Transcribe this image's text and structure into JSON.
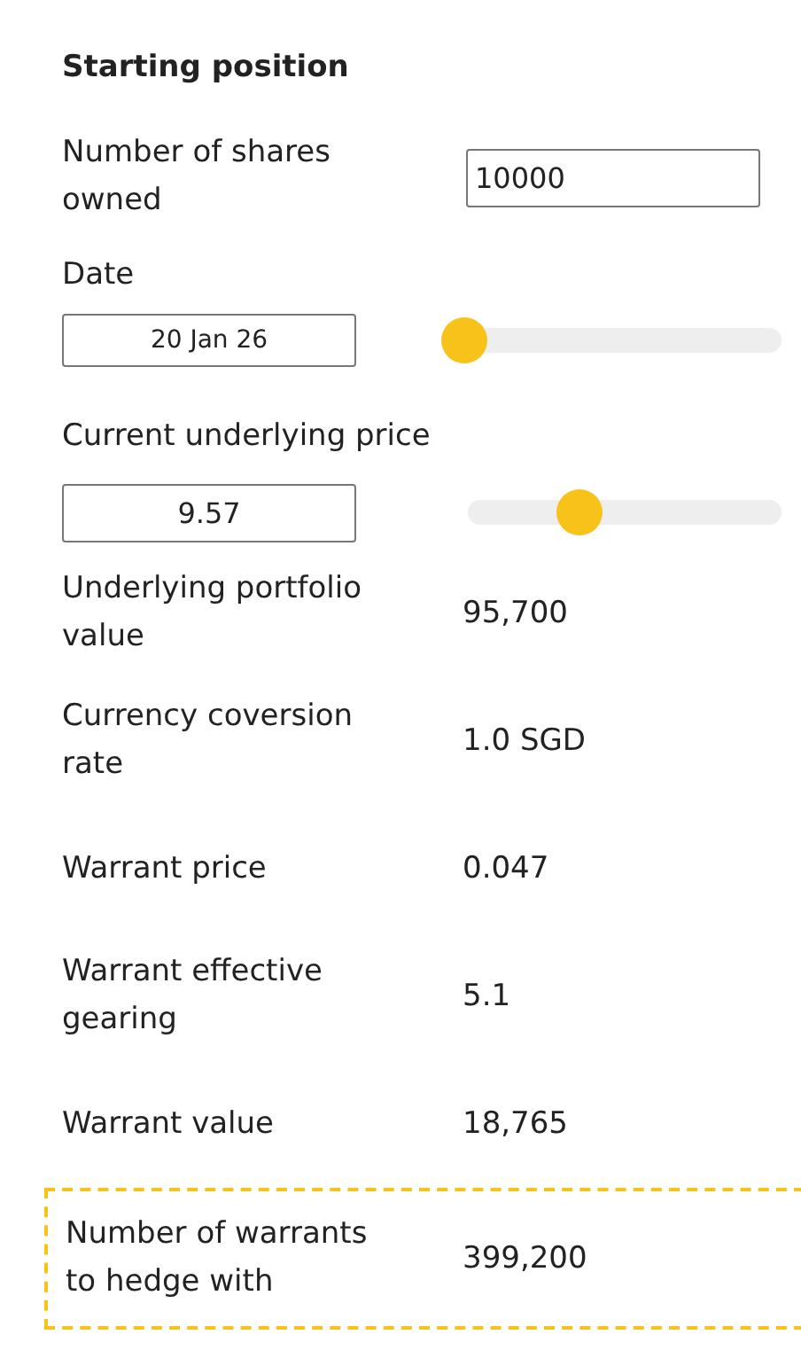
{
  "title": "Starting position",
  "shares": {
    "label": "Number of shares owned",
    "value": "10000"
  },
  "date": {
    "label": "Date",
    "value": "20 Jan 26",
    "level": 0
  },
  "price": {
    "label": "Current underlying price",
    "value": "9.57",
    "level": 0.33
  },
  "rows": [
    {
      "label": "Underlying portfolio value",
      "value": "95,700",
      "highlighted": false
    },
    {
      "label": "Currency coversion rate",
      "value": "1.0 SGD",
      "highlighted": false
    },
    {
      "label": "Warrant price",
      "value": "0.047",
      "highlighted": false
    },
    {
      "label": "Warrant effective gearing",
      "value": "5.1",
      "highlighted": false
    },
    {
      "label": "Warrant value",
      "value": "18,765",
      "highlighted": false
    },
    {
      "label": "Number of warrants to hedge with",
      "value": "399,200",
      "highlighted": true
    }
  ]
}
